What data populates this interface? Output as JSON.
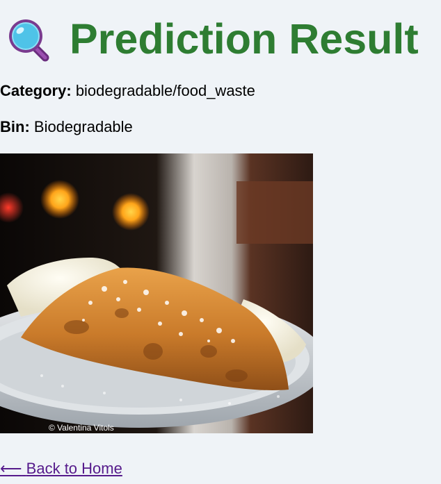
{
  "header": {
    "icon": "magnifying-glass-icon",
    "title": "Prediction Result",
    "title_color": "#2e7d32"
  },
  "result": {
    "category_label": "Category:",
    "category_value": "biodegradable/food_waste",
    "bin_label": "Bin:",
    "bin_value": "Biodegradable"
  },
  "image": {
    "subject": "cannoli on a plate dusted with powdered sugar",
    "credit": "© Valentina Vitols"
  },
  "nav": {
    "back_arrow": "⟵",
    "back_label": "Back to Home",
    "link_color": "#551a8b"
  }
}
